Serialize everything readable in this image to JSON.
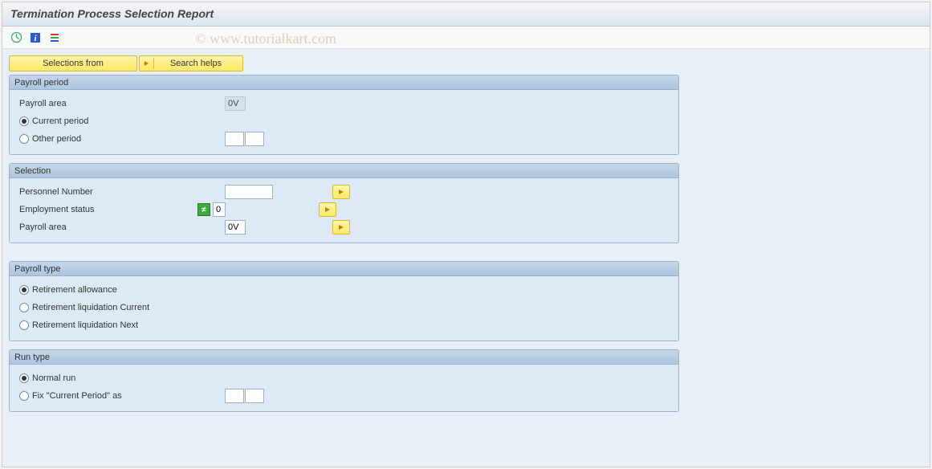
{
  "title": "Termination Process Selection Report",
  "watermark": "© www.tutorialkart.com",
  "toolbar": {
    "icons": [
      "execute",
      "info",
      "variants"
    ]
  },
  "highlight_buttons": {
    "selections_from": "Selections from",
    "search_helps": "Search helps"
  },
  "groups": {
    "payroll_period": {
      "title": "Payroll period",
      "rows": {
        "payroll_area_label": "Payroll area",
        "payroll_area_value": "0V",
        "current_period_label": "Current period",
        "other_period_label": "Other period"
      },
      "selected_radio": "current_period"
    },
    "selection": {
      "title": "Selection",
      "rows": {
        "personnel_number_label": "Personnel Number",
        "personnel_number_value": "",
        "employment_status_label": "Employment status",
        "employment_status_indicator": "≠",
        "employment_status_value": "0",
        "payroll_area_label": "Payroll area",
        "payroll_area_value": "0V"
      }
    },
    "payroll_type": {
      "title": "Payroll type",
      "options": {
        "retirement_allowance": "Retirement allowance",
        "retirement_liquidation_current": "Retirement liquidation Current",
        "retirement_liquidation_next": "Retirement liquidation Next"
      },
      "selected": "retirement_allowance"
    },
    "run_type": {
      "title": "Run type",
      "options": {
        "normal_run": "Normal run",
        "fix_current_period": "Fix \"Current Period\" as"
      },
      "selected": "normal_run"
    }
  }
}
